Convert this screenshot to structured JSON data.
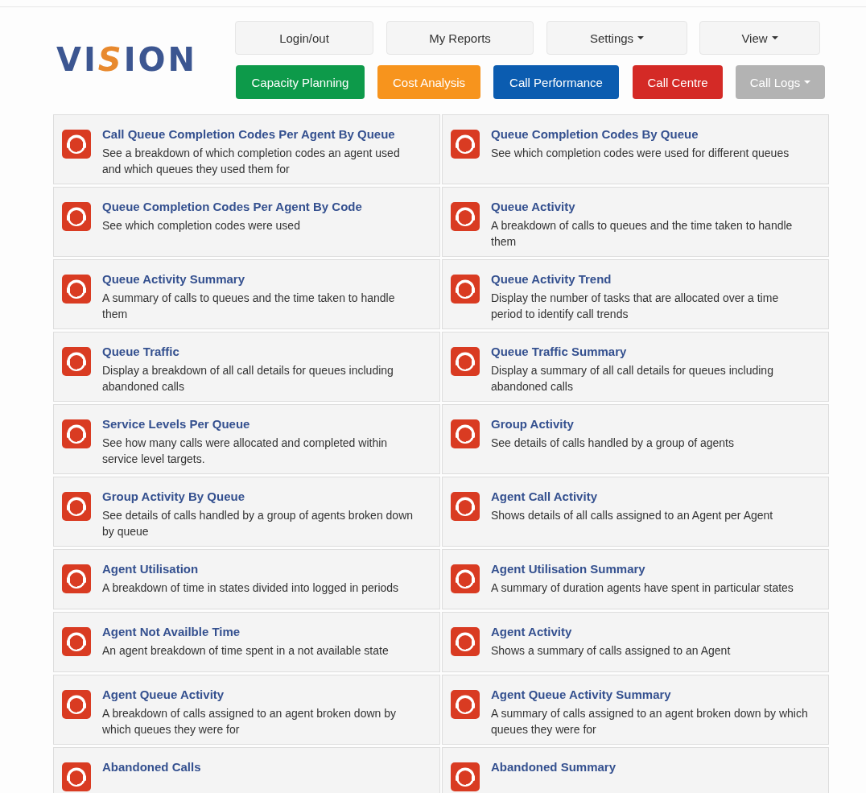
{
  "logo": {
    "text": "VISION"
  },
  "nav_top": [
    {
      "label": "Login/out",
      "dropdown": false
    },
    {
      "label": "My Reports",
      "dropdown": false
    },
    {
      "label": "Settings",
      "dropdown": true
    },
    {
      "label": "View",
      "dropdown": true
    }
  ],
  "nav_sections": [
    {
      "label": "Capacity Planning",
      "color": "#0d9a4a",
      "dropdown": false
    },
    {
      "label": "Cost Analysis",
      "color": "#f7941d",
      "dropdown": false
    },
    {
      "label": "Call Performance",
      "color": "#0b5cb0",
      "dropdown": false
    },
    {
      "label": "Call Centre",
      "color": "#d42a26",
      "dropdown": false
    },
    {
      "label": "Call Logs",
      "color": "#b3b3b3",
      "dropdown": true
    }
  ],
  "reports": [
    {
      "title": "Call Queue Completion Codes Per Agent By Queue",
      "description": "See a breakdown of which completion codes an agent used and which queues they used them for"
    },
    {
      "title": "Queue Completion Codes By Queue",
      "description": "See which completion codes were used for different queues"
    },
    {
      "title": "Queue Completion Codes Per Agent By Code",
      "description": "See which completion codes were used"
    },
    {
      "title": "Queue Activity",
      "description": "A breakdown of calls to queues and the time taken to handle them"
    },
    {
      "title": "Queue Activity Summary",
      "description": "A summary of calls to queues and the time taken to handle them"
    },
    {
      "title": "Queue Activity Trend",
      "description": "Display the number of tasks that are allocated over a time period to identify call trends"
    },
    {
      "title": "Queue Traffic",
      "description": "Display a breakdown of all call details for queues including abandoned calls"
    },
    {
      "title": "Queue Traffic Summary",
      "description": "Display a summary of all call details for queues including abandoned calls"
    },
    {
      "title": "Service Levels Per Queue",
      "description": "See how many calls were allocated and completed within service level targets."
    },
    {
      "title": "Group Activity",
      "description": "See details of calls handled by a group of agents"
    },
    {
      "title": "Group Activity By Queue",
      "description": "See details of calls handled by a group of agents broken down by queue"
    },
    {
      "title": "Agent Call Activity",
      "description": "Shows details of all calls assigned to an Agent per Agent"
    },
    {
      "title": "Agent Utilisation",
      "description": "A breakdown of time in states divided into logged in periods"
    },
    {
      "title": "Agent Utilisation Summary",
      "description": "A summary of duration agents have spent in particular states"
    },
    {
      "title": "Agent Not Availble Time",
      "description": "An agent breakdown of time spent in a not available state"
    },
    {
      "title": "Agent Activity",
      "description": "Shows a summary of calls assigned to an Agent"
    },
    {
      "title": "Agent Queue Activity",
      "description": "A breakdown of calls assigned to an agent broken down by which queues they were for"
    },
    {
      "title": "Agent Queue Activity Summary",
      "description": "A summary of calls assigned to an agent broken down by which queues they were for"
    },
    {
      "title": "Abandoned Calls"
    },
    {
      "title": "Abandoned Summary"
    }
  ]
}
